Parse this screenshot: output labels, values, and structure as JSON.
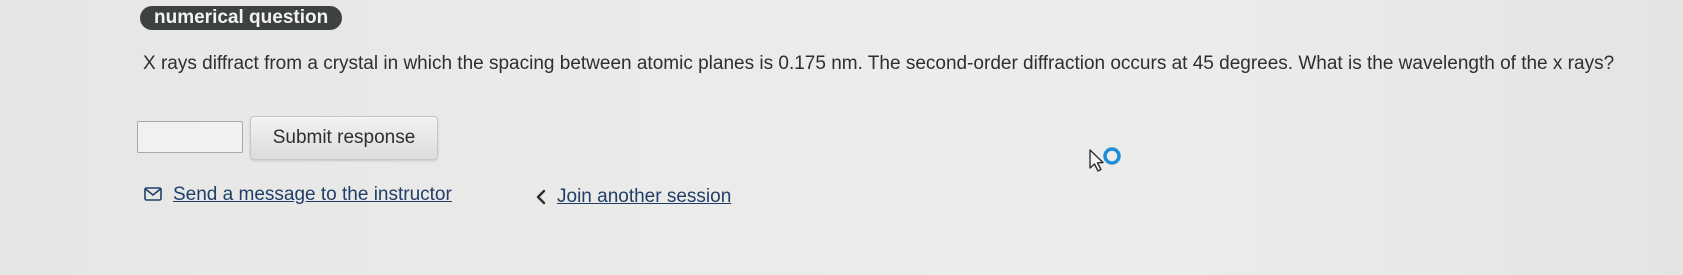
{
  "badge": {
    "label": "numerical question"
  },
  "question": {
    "text": "X rays diffract from a crystal in which the spacing between atomic planes is 0.175 nm. The second-order diffraction occurs at 45 degrees. What is the wavelength of the x rays?"
  },
  "answer": {
    "value": "",
    "placeholder": ""
  },
  "submit": {
    "label": "Submit response"
  },
  "links": {
    "message": {
      "icon": "envelope-icon",
      "label": "Send a message to the instructor"
    },
    "join": {
      "icon": "chevron-left-icon",
      "label": "Join another session"
    }
  },
  "colors": {
    "background": "#ebebe9",
    "badge_bg": "#3e4142",
    "link": "#1f3f6a",
    "cursor_accent": "#1e8fd6"
  }
}
